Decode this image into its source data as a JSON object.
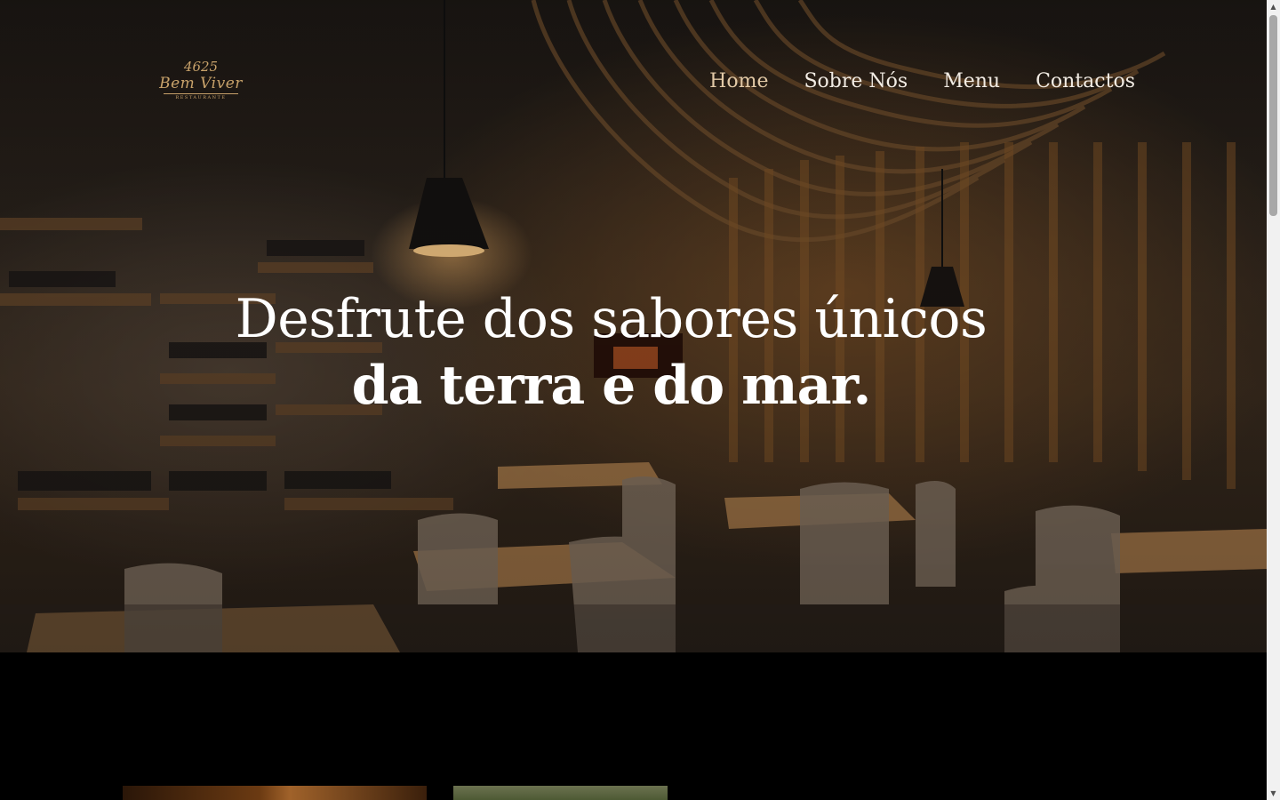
{
  "brand": {
    "logo_number": "4625",
    "logo_name": "Bem Viver",
    "logo_subtitle": "RESTAURANTE"
  },
  "nav": {
    "items": [
      {
        "label": "Home",
        "active": true
      },
      {
        "label": "Sobre Nós",
        "active": false
      },
      {
        "label": "Menu",
        "active": false
      },
      {
        "label": "Contactos",
        "active": false
      }
    ]
  },
  "hero": {
    "headline_line1": "Desfrute dos sabores únicos",
    "headline_line2": "da terra e do mar."
  },
  "colors": {
    "accent": "#c8a26a",
    "nav_active": "#e2c9a6",
    "page_background": "#000000"
  }
}
